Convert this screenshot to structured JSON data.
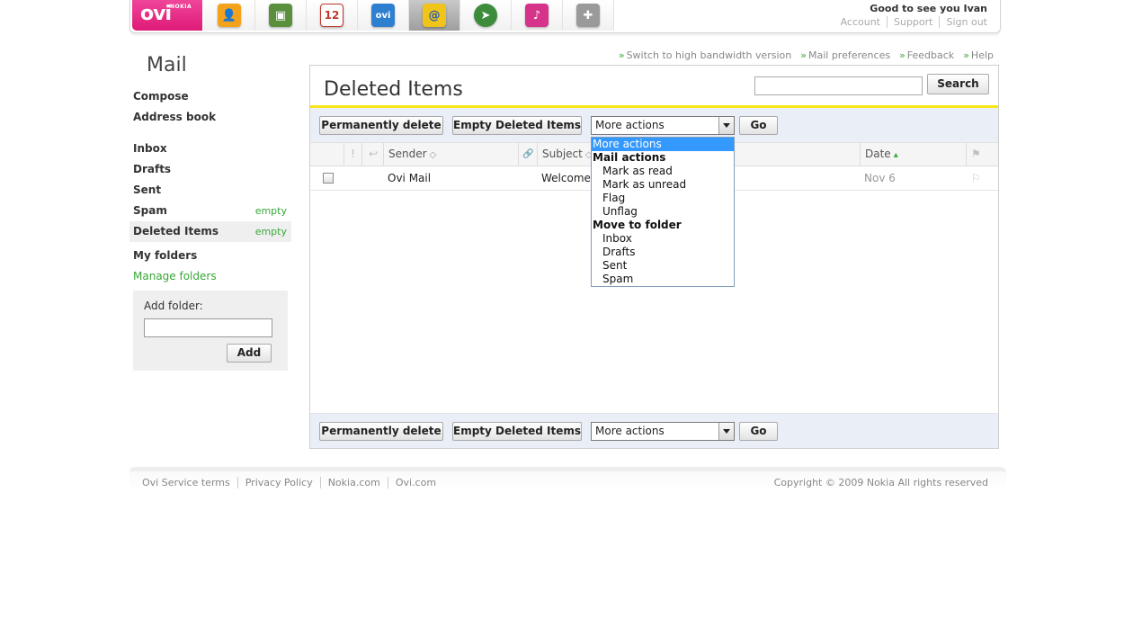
{
  "header": {
    "logo_text": "ovi",
    "logo_sub": "NOKIA",
    "greeting": "Good to see you Ivan",
    "account_links": [
      "Account",
      "Support",
      "Sign out"
    ],
    "apps": [
      {
        "icon": "contacts-icon",
        "glyph": "👤",
        "color": "#f2a31b"
      },
      {
        "icon": "photos-icon",
        "glyph": "▣",
        "color": "#5a8f3e"
      },
      {
        "icon": "calendar-icon",
        "glyph": "12",
        "color": "#d9534f"
      },
      {
        "icon": "files-icon",
        "glyph": "ovi",
        "color": "#2f7fd1"
      },
      {
        "icon": "mail-icon",
        "glyph": "@",
        "color": "#f0c419"
      },
      {
        "icon": "maps-icon",
        "glyph": "➤",
        "color": "#3c8c3c"
      },
      {
        "icon": "music-icon",
        "glyph": "♪",
        "color": "#d6338a"
      },
      {
        "icon": "games-icon",
        "glyph": "✚",
        "color": "#7a7a7a"
      }
    ]
  },
  "sidebar": {
    "title": "Mail",
    "compose": "Compose",
    "address_book": "Address book",
    "folders": {
      "inbox": "Inbox",
      "drafts": "Drafts",
      "sent": "Sent",
      "spam": "Spam",
      "spam_empty": "empty",
      "deleted": "Deleted Items",
      "deleted_empty": "empty"
    },
    "my_folders": "My folders",
    "manage_folders": "Manage folders",
    "add_folder_label": "Add folder:",
    "add_folder_value": "",
    "add_button": "Add"
  },
  "top_links": [
    "Switch to high bandwidth version",
    "Mail preferences",
    "Feedback",
    "Help"
  ],
  "top_links_prefix": "»",
  "main": {
    "folder_title": "Deleted Items",
    "search_value": "",
    "search_button": "Search",
    "toolbar": {
      "perm_delete": "Permanently delete",
      "empty_deleted": "Empty Deleted Items",
      "more_actions": "More actions",
      "go": "Go"
    },
    "columns": {
      "priority": "!",
      "reply": "↩",
      "sender": "Sender",
      "attachment": "🔗",
      "subject": "Subject",
      "date": "Date",
      "flag": "⚑",
      "sort_mark": "◇",
      "date_sort_mark": "▴"
    },
    "rows": [
      {
        "sender": "Ovi Mail",
        "subject": "Welcome",
        "date": "Nov 6",
        "flag": "⚐"
      }
    ]
  },
  "dropdown": {
    "selected": "More actions",
    "group_mail": "Mail actions",
    "mail_actions": [
      "Mark as read",
      "Mark as unread",
      "Flag",
      "Unflag"
    ],
    "group_move": "Move to folder",
    "move_targets": [
      "Inbox",
      "Drafts",
      "Sent",
      "Spam"
    ]
  },
  "footer": {
    "links": [
      "Ovi Service terms",
      "Privacy Policy",
      "Nokia.com",
      "Ovi.com"
    ],
    "copyright": "Copyright © 2009 Nokia All rights reserved"
  }
}
